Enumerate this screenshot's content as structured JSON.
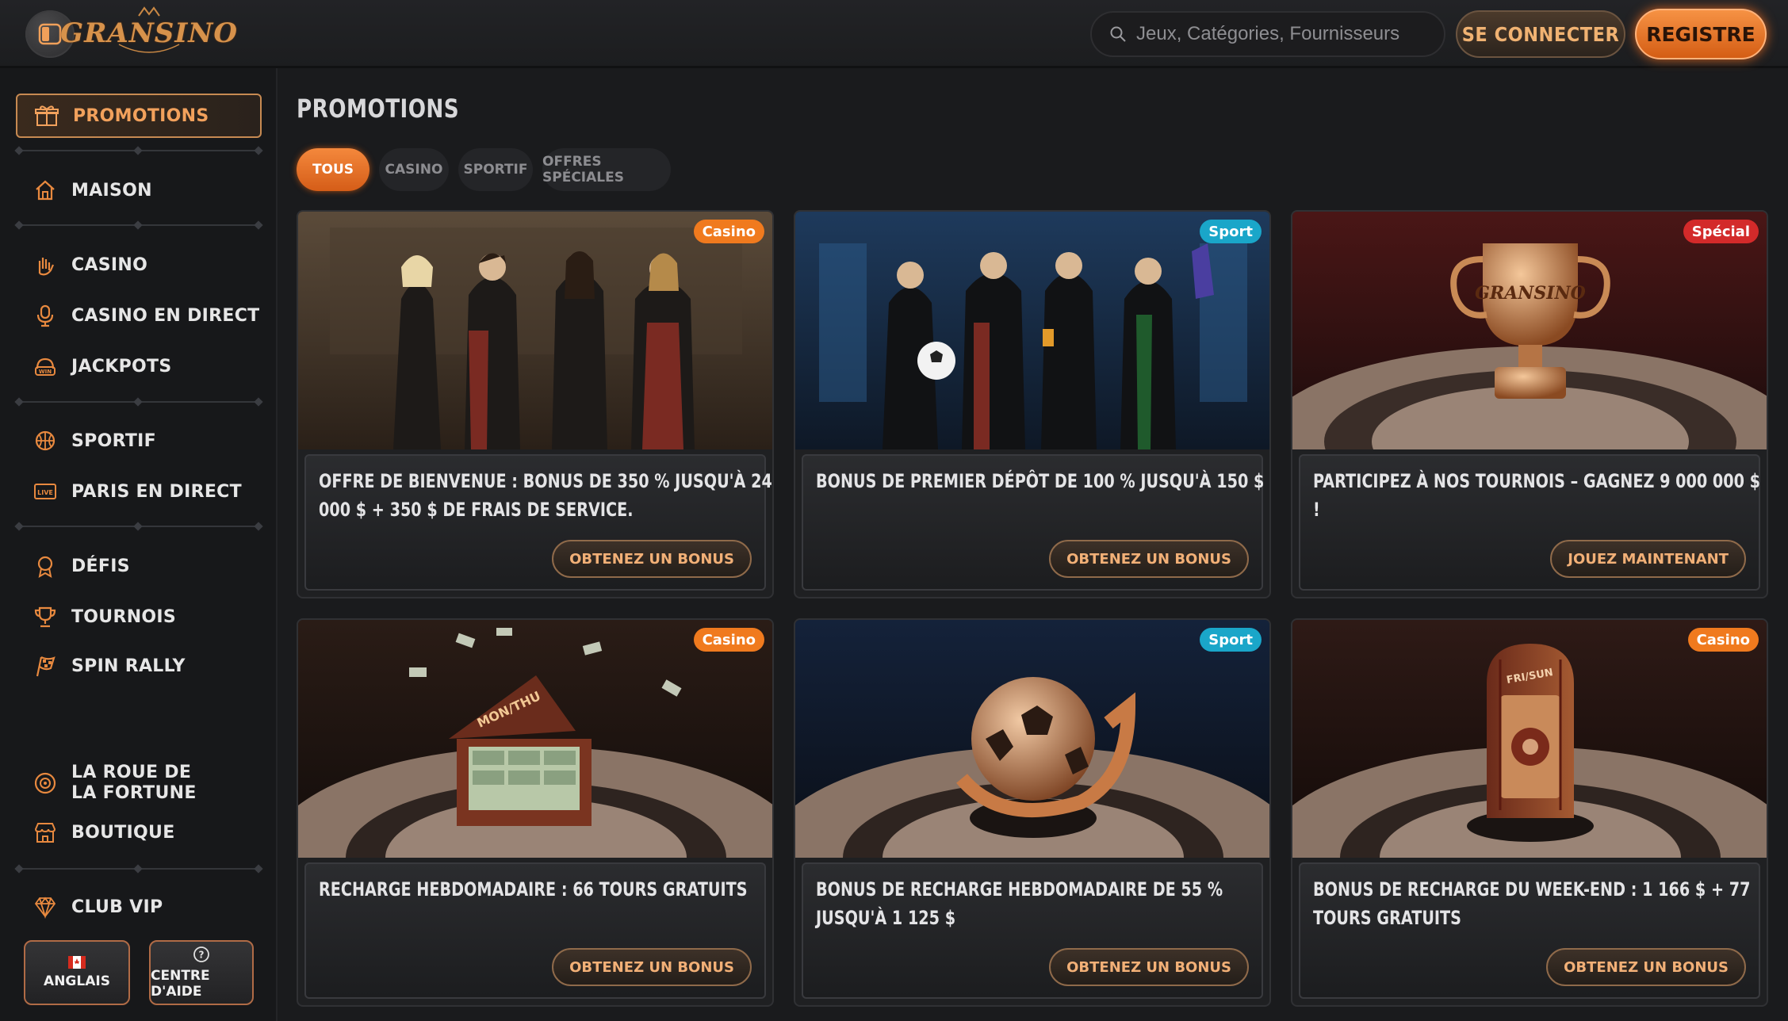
{
  "header": {
    "logo_text": "GRANSINO",
    "search_placeholder": "Jeux, Catégories, Fournisseurs",
    "login_label": "SE CONNECTER",
    "register_label": "REGISTRE"
  },
  "sidebar": {
    "promotions": "PROMOTIONS",
    "items": [
      {
        "label": "MAISON",
        "icon": "home-icon"
      },
      {
        "label": "CASINO",
        "icon": "casino-hand-icon"
      },
      {
        "label": "CASINO EN DIRECT",
        "icon": "microphone-icon"
      },
      {
        "label": "JACKPOTS",
        "icon": "jackpot-win-icon"
      },
      {
        "label": "SPORTIF",
        "icon": "basketball-icon"
      },
      {
        "label": "PARIS EN DIRECT",
        "icon": "live-icon"
      },
      {
        "label": "DÉFIS",
        "icon": "medal-icon"
      },
      {
        "label": "TOURNOIS",
        "icon": "trophy-icon"
      },
      {
        "label": "SPIN RALLY",
        "icon": "checkered-flag-icon"
      },
      {
        "label": "LA ROUE DE LA FORTUNE",
        "icon": "fortune-wheel-icon"
      },
      {
        "label": "BOUTIQUE",
        "icon": "shop-icon"
      },
      {
        "label": "CLUB VIP",
        "icon": "diamond-icon"
      }
    ],
    "live_badge": "LIVE",
    "language_label": "ANGLAIS",
    "help_label": "CENTRE D'AIDE"
  },
  "main": {
    "title": "PROMOTIONS",
    "tabs": [
      "TOUS",
      "CASINO",
      "SPORTIF",
      "OFFRES SPÉCIALES"
    ],
    "cards": [
      {
        "badge": "Casino",
        "badge_color": "#f07a1e",
        "title": "OFFRE DE BIENVENUE : BONUS DE 350 % JUSQU'À 24 000 $ + 350 $ DE FRAIS DE SERVICE.",
        "button": "OBTENEZ UN BONUS"
      },
      {
        "badge": "Sport",
        "badge_color": "#1aa6c9",
        "title": "BONUS DE PREMIER DÉPÔT DE 100 % JUSQU'À 150 $",
        "button": "OBTENEZ UN BONUS"
      },
      {
        "badge": "Spécial",
        "badge_color": "#d32a2a",
        "title": "PARTICIPEZ À NOS TOURNOIS – GAGNEZ 9 000 000 $ !",
        "button": "JOUEZ MAINTENANT"
      },
      {
        "badge": "Casino",
        "badge_color": "#f07a1e",
        "title": "RECHARGE HEBDOMADAIRE : 66 TOURS GRATUITS",
        "button": "OBTENEZ UN BONUS"
      },
      {
        "badge": "Sport",
        "badge_color": "#1aa6c9",
        "title": "BONUS DE RECHARGE HEBDOMADAIRE DE 55 % JUSQU'À 1 125 $",
        "button": "OBTENEZ UN BONUS"
      },
      {
        "badge": "Casino",
        "badge_color": "#f07a1e",
        "title": "BONUS DE RECHARGE DU WEEK-END : 1 166 $ + 77 TOURS GRATUITS",
        "button": "OBTENEZ UN BONUS"
      }
    ],
    "image_labels": {
      "suitcase": "MON/THU",
      "safe": "FRI/SUN",
      "trophy": "GRANSINO"
    }
  },
  "colors": {
    "accent": "#f07a1e",
    "background": "#1a1b1d",
    "sport": "#1aa6c9",
    "special": "#d32a2a"
  }
}
